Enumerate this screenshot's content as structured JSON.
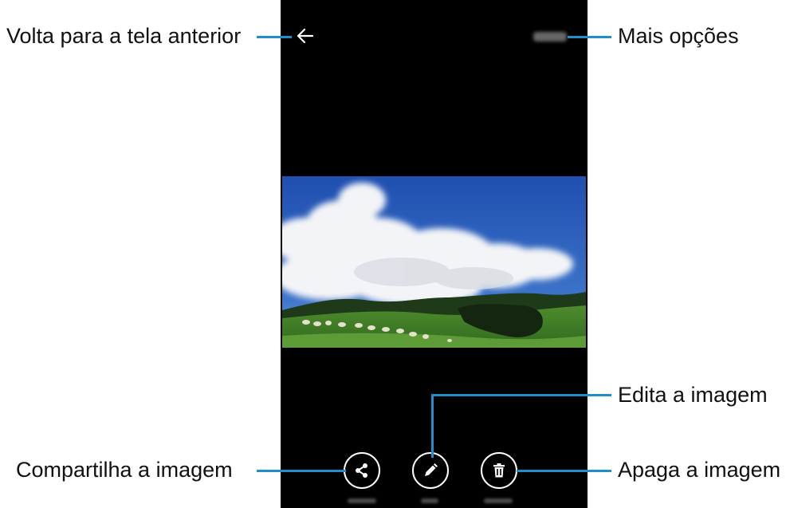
{
  "callouts": {
    "back": "Volta para a tela anterior",
    "more": "Mais opções",
    "edit": "Edita a imagem",
    "share": "Compartilha a imagem",
    "delete": "Apaga a imagem"
  },
  "icons": {
    "back": "arrow-left-icon",
    "share": "share-icon",
    "edit": "pencil-icon",
    "delete": "trash-icon"
  },
  "colors": {
    "leader": "#1f8fc9",
    "screen_bg": "#000000"
  }
}
